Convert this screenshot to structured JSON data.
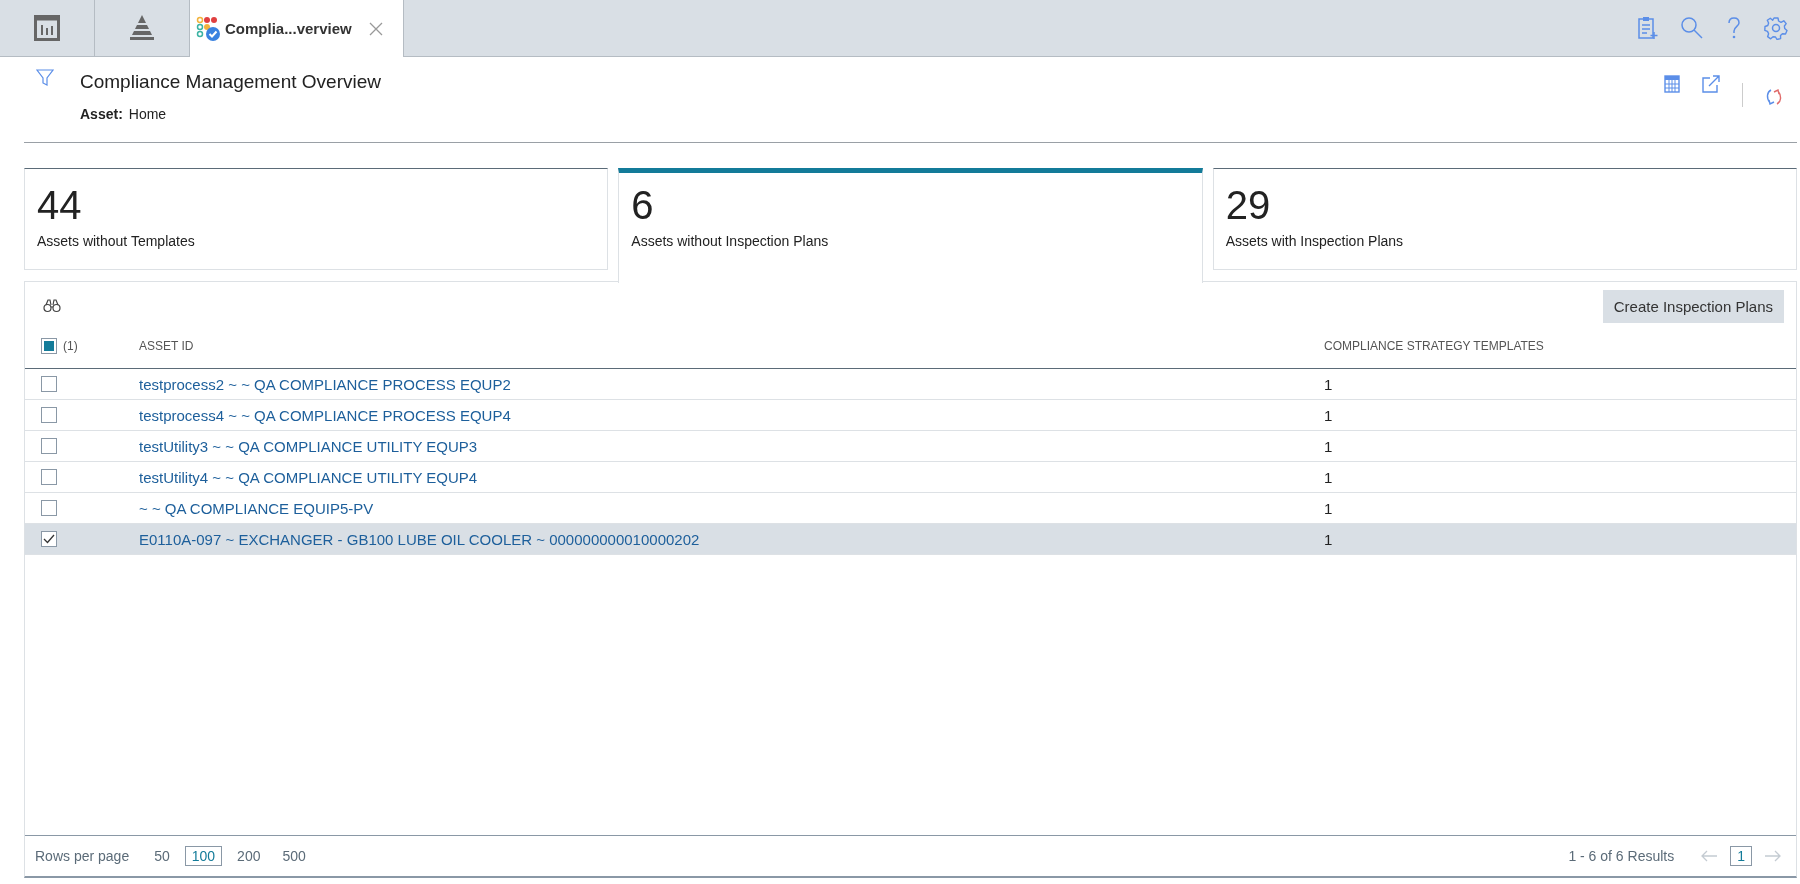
{
  "app_tabs": [
    {
      "kind": "dashboard",
      "selected": false
    },
    {
      "kind": "pyramid",
      "selected": false
    },
    {
      "kind": "app",
      "label": "Complia...verview",
      "selected": true
    }
  ],
  "header": {
    "title": "Compliance Management Overview",
    "asset_label": "Asset:",
    "asset_value": "Home"
  },
  "cards": [
    {
      "count": "44",
      "label": "Assets without Templates",
      "selected": false
    },
    {
      "count": "6",
      "label": "Assets without Inspection Plans",
      "selected": true
    },
    {
      "count": "29",
      "label": "Assets with Inspection Plans",
      "selected": false
    }
  ],
  "grid": {
    "button": "Create Inspection Plans",
    "select_all": {
      "indeterminate": true,
      "count": "(1)"
    },
    "columns": [
      "ASSET ID",
      "COMPLIANCE STRATEGY TEMPLATES"
    ],
    "rows": [
      {
        "asset": "testprocess2 ~ ~ QA COMPLIANCE PROCESS EQUP2",
        "templates": "1",
        "selected": false
      },
      {
        "asset": "testprocess4 ~ ~ QA COMPLIANCE PROCESS EQUP4",
        "templates": "1",
        "selected": false
      },
      {
        "asset": "testUtility3 ~ ~ QA COMPLIANCE UTILITY EQUP3",
        "templates": "1",
        "selected": false
      },
      {
        "asset": "testUtility4 ~ ~ QA COMPLIANCE UTILITY EQUP4",
        "templates": "1",
        "selected": false
      },
      {
        "asset": "~ ~ QA COMPLIANCE EQUIP5-PV",
        "templates": "1",
        "selected": false
      },
      {
        "asset": "E0110A-097 ~ EXCHANGER - GB100 LUBE OIL COOLER ~ 000000000010000202",
        "templates": "1",
        "selected": true
      }
    ]
  },
  "footer": {
    "rows_label": "Rows per page",
    "page_sizes": [
      {
        "label": "50",
        "selected": false
      },
      {
        "label": "100",
        "selected": true
      },
      {
        "label": "200",
        "selected": false
      },
      {
        "label": "500",
        "selected": false
      }
    ],
    "results": "1 - 6 of 6 Results",
    "page": "1"
  }
}
